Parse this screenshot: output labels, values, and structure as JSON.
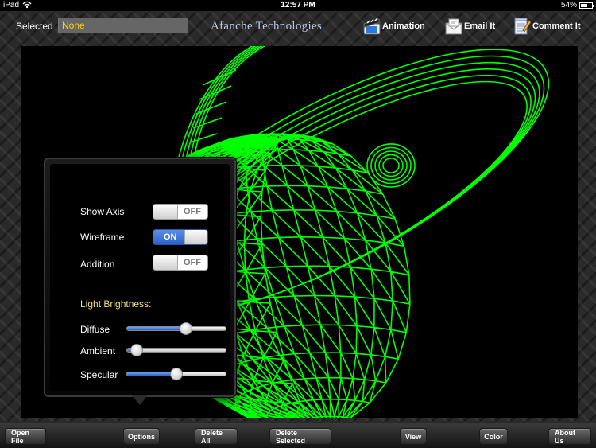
{
  "status_bar": {
    "device": "iPad",
    "time": "12:57 PM",
    "battery_text": "54%",
    "battery_level": 0.54
  },
  "toolbar": {
    "selected_label": "Selected",
    "selected_value": "None",
    "brand": "Afanche Technologies",
    "buttons": [
      {
        "label": "Animation",
        "icon": "film-clapper-icon"
      },
      {
        "label": "Email It",
        "icon": "envelope-icon"
      },
      {
        "label": "Comment It",
        "icon": "notepad-pencil-icon"
      }
    ]
  },
  "viewport": {
    "wireframe_color": "#00ff00",
    "background": "#000000"
  },
  "options_popover": {
    "toggles": [
      {
        "label": "Show Axis",
        "state": "OFF"
      },
      {
        "label": "Wireframe",
        "state": "ON"
      },
      {
        "label": "Addition",
        "state": "OFF"
      }
    ],
    "section_title": "Light Brightness:",
    "sliders": [
      {
        "label": "Diffuse",
        "value": 0.6
      },
      {
        "label": "Ambient",
        "value": 0.1
      },
      {
        "label": "Specular",
        "value": 0.5
      }
    ]
  },
  "bottom_bar": {
    "buttons": [
      "Open File",
      "Options",
      "Delete All",
      "Delete Selected",
      "View",
      "Color",
      "About Us"
    ]
  },
  "colors": {
    "accent_blue": "#2b62cc",
    "highlight_yellow": "#ffd400",
    "section_title": "#f2de7d"
  }
}
